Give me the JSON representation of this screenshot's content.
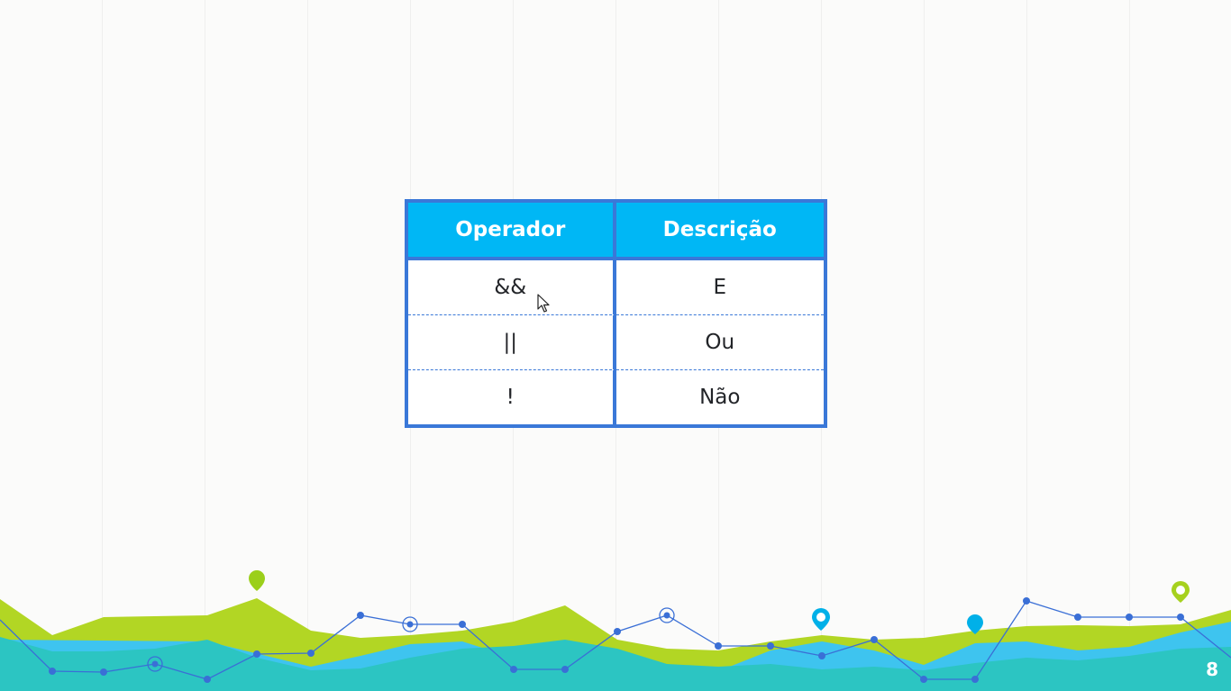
{
  "table": {
    "headers": [
      "Operador",
      "Descrição"
    ],
    "rows": [
      [
        "&&",
        "E"
      ],
      [
        "||",
        "Ou"
      ],
      [
        "!",
        "Não"
      ]
    ]
  },
  "page_number": "8",
  "colors": {
    "header_bg": "#00b7f5",
    "border": "#3a78d8",
    "lime": "#b2d624",
    "teal": "#2cc5c2",
    "sky": "#3ec4ef",
    "line": "#3a6fd6"
  },
  "icons": [
    "mouse-pointer-icon",
    "map-pin-icon"
  ]
}
